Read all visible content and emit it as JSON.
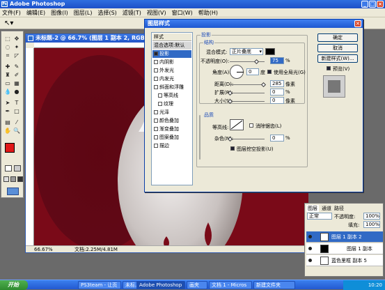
{
  "app": {
    "title": "Adobe Photoshop"
  },
  "menu": [
    "文件(F)",
    "编辑(E)",
    "图像(I)",
    "图层(L)",
    "选择(S)",
    "滤镜(T)",
    "视图(V)",
    "窗口(W)",
    "帮助(H)"
  ],
  "document": {
    "title": "未标题-2 @ 66.7% (图层 1 副本 2, RGB)",
    "zoom": "66.67%",
    "status": "文档:2.25M/4.81M"
  },
  "dialog": {
    "title": "图层样式",
    "style_list": {
      "header": "样式",
      "blend_default": "混合选项:默认",
      "items": [
        {
          "label": "投影",
          "checked": true,
          "selected": true
        },
        {
          "label": "内阴影",
          "checked": false
        },
        {
          "label": "外发光",
          "checked": false
        },
        {
          "label": "内发光",
          "checked": false
        },
        {
          "label": "斜面和浮雕",
          "checked": false
        },
        {
          "label": "等高线",
          "checked": false,
          "sub": true
        },
        {
          "label": "纹理",
          "checked": false,
          "sub": true
        },
        {
          "label": "光泽",
          "checked": false
        },
        {
          "label": "颜色叠加",
          "checked": false
        },
        {
          "label": "渐变叠加",
          "checked": false
        },
        {
          "label": "图案叠加",
          "checked": false
        },
        {
          "label": "描边",
          "checked": false
        }
      ]
    },
    "shadow": {
      "group_title": "投影",
      "structure_title": "结构",
      "blend_mode_label": "混合模式:",
      "blend_mode": "正片叠底",
      "opacity_label": "不透明度(O):",
      "opacity": "75",
      "percent": "%",
      "angle_label": "角度(A):",
      "angle": "0",
      "degree_unit": "度",
      "global_light_label": "使用全局光(G)",
      "distance_label": "距离(D):",
      "distance": "285",
      "spread_label": "扩展(R):",
      "spread": "0",
      "size_label": "大小(S):",
      "size": "0",
      "px_unit": "像素",
      "quality_title": "品质",
      "contour_label": "等高线:",
      "antialias_label": "消除锯齿(L)",
      "noise_label": "杂色(N):",
      "noise": "0",
      "knockout_label": "图层挖空投影(U)"
    },
    "buttons": {
      "ok": "确定",
      "cancel": "取消",
      "new_style": "新建样式(W)...",
      "preview": "预览(V)"
    }
  },
  "layers_panel": {
    "tabs": [
      "图层",
      "通道",
      "路径"
    ],
    "blend": "正常",
    "opacity_label": "不透明度:",
    "opacity": "100%",
    "fill_label": "填充:",
    "fill": "100%",
    "rows": [
      {
        "name": "图层 1 副本 2",
        "selected": true
      },
      {
        "name": "图层 1 副本",
        "selected": false
      },
      {
        "name": "蓝色里框 副本 5",
        "selected": false
      }
    ]
  },
  "taskbar": {
    "start": "开始",
    "tasks": [
      "未标...",
      "画夹",
      "PS3team - 让页",
      "Adobe Photoshop",
      "文档 1 - Micros",
      "新建文件夹"
    ],
    "time": "10:20"
  },
  "colors": {
    "canvas": "#7a0a18",
    "foreground": "#e01818",
    "selection": "#316ac5"
  }
}
